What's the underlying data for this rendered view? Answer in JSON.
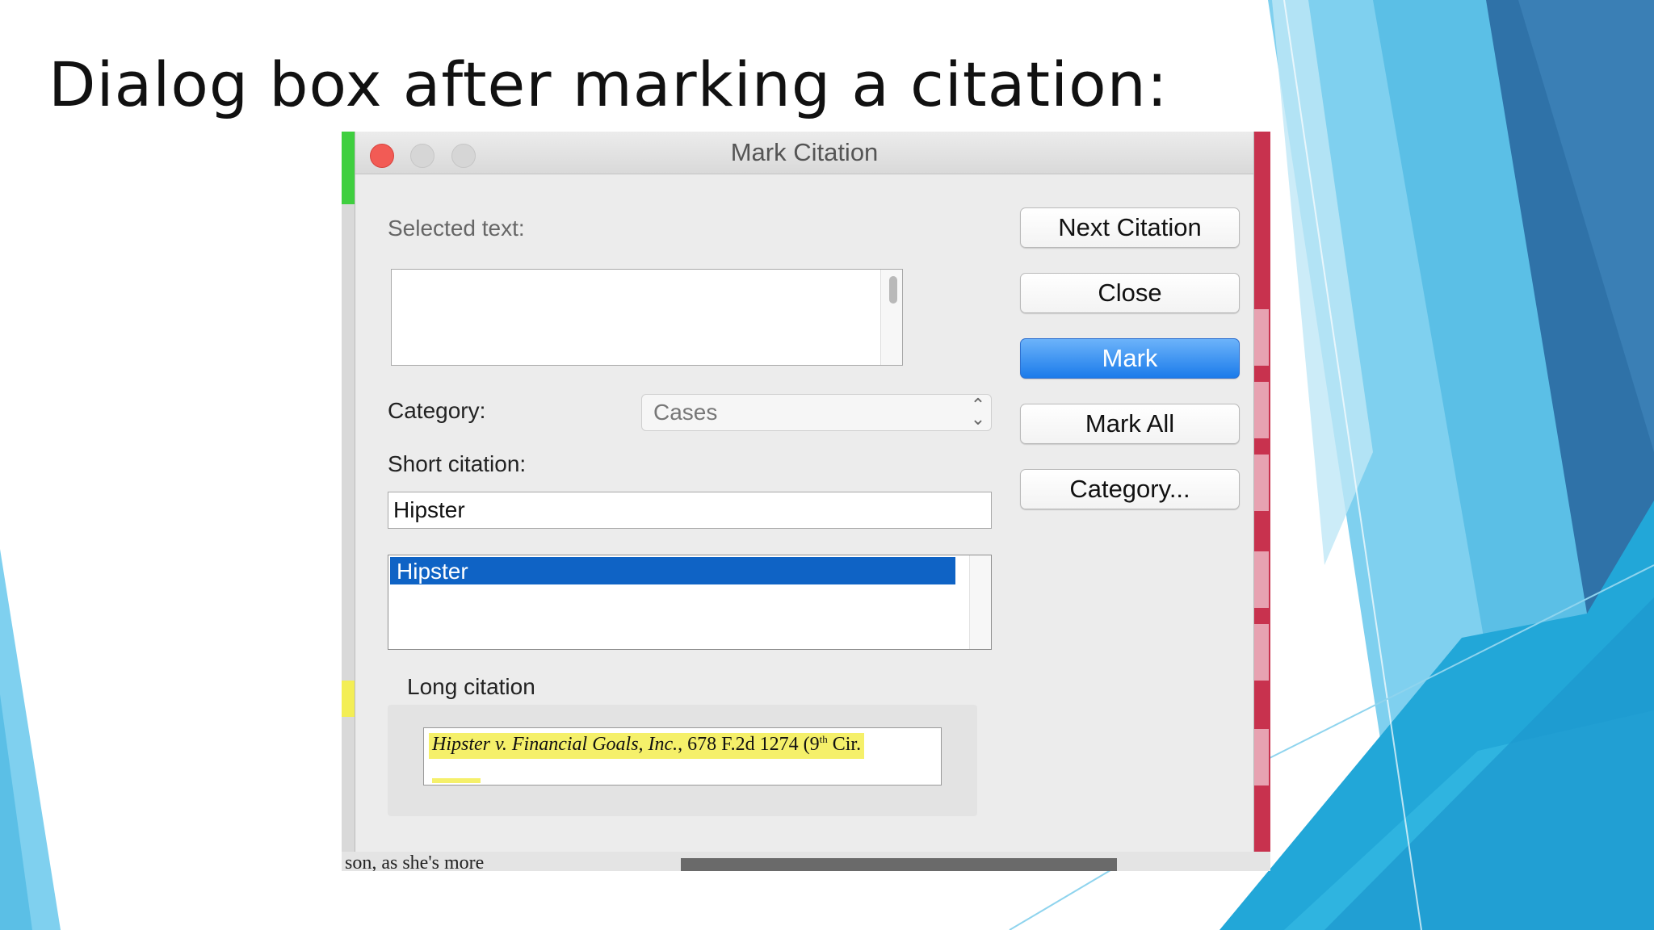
{
  "slide": {
    "title": "Dialog box after marking a citation:"
  },
  "dialog": {
    "window_title": "Mark Citation",
    "selected_text_label": "Selected text:",
    "selected_text_value": "",
    "category_label": "Category:",
    "category_value": "Cases",
    "short_citation_label": "Short citation:",
    "short_citation_value": "Hipster",
    "short_citation_list": [
      "Hipster"
    ],
    "long_citation_label": "Long citation",
    "long_citation": {
      "italic": "Hipster v. Financial Goals, Inc.",
      "rest": ", 678 F.2d 1274 (9",
      "superscript": "th",
      "tail": " Cir."
    },
    "buttons": {
      "next_citation": "Next Citation",
      "close": "Close",
      "mark": "Mark",
      "mark_all": "Mark All",
      "category": "Category..."
    }
  },
  "background_document": {
    "bottom_text": "son, as she's more"
  },
  "colors": {
    "accent_button": "#1b7bea",
    "list_selection": "#0f63c5",
    "highlight": "#f5f06a",
    "slide_blue_light": "#7fd0ef",
    "slide_blue_dark": "#2f72a8"
  }
}
